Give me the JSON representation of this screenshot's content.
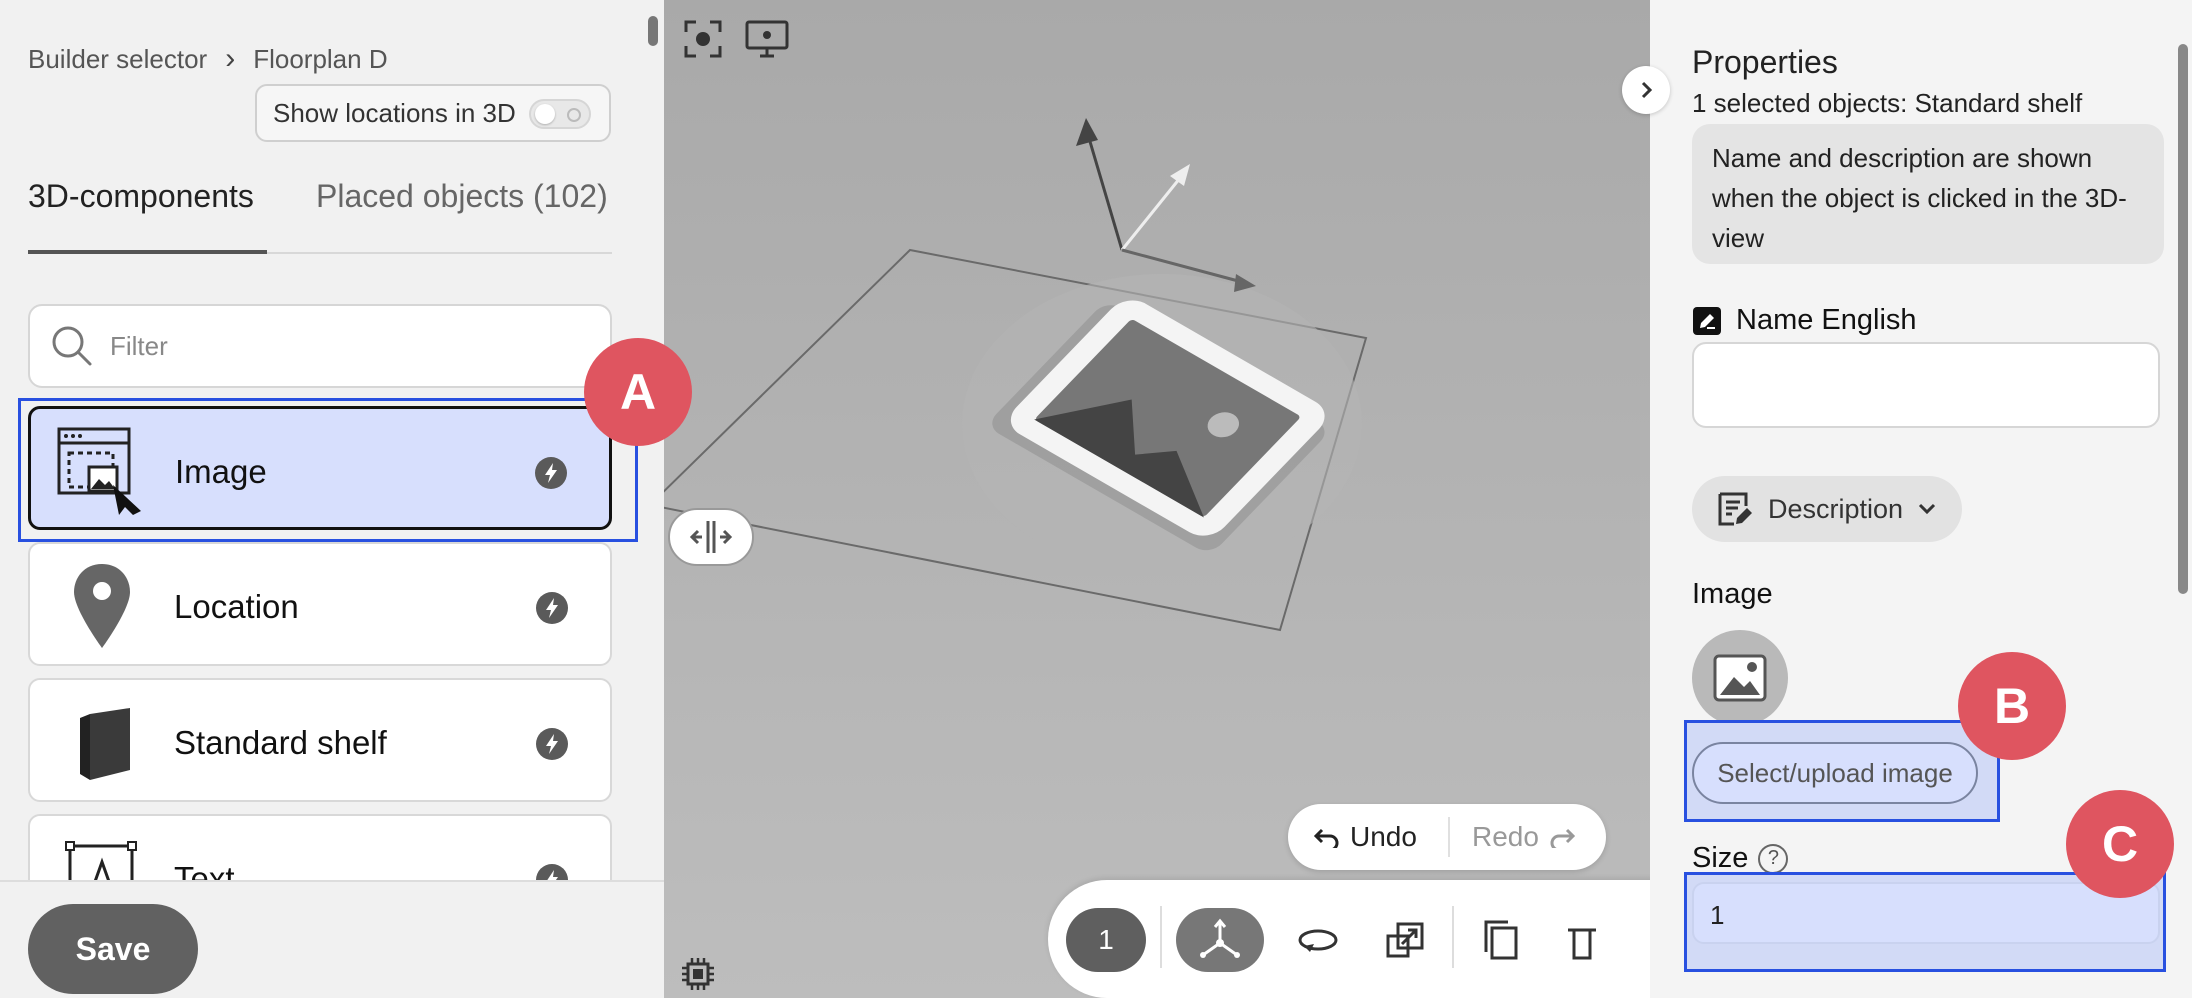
{
  "breadcrumb": {
    "root": "Builder selector",
    "current": "Floorplan D"
  },
  "show_locations_toggle": {
    "label": "Show locations in 3D",
    "checked": false
  },
  "tabs": [
    {
      "label": "3D-components",
      "active": true
    },
    {
      "label": "Placed objects (102)",
      "active": false
    }
  ],
  "filter": {
    "placeholder": "Filter"
  },
  "components": [
    {
      "label": "Image",
      "icon": "image-component-icon",
      "selected": true
    },
    {
      "label": "Location",
      "icon": "location-pin-icon",
      "selected": false
    },
    {
      "label": "Standard shelf",
      "icon": "shelf-cube-icon",
      "selected": false
    },
    {
      "label": "Text",
      "icon": "text-frame-icon",
      "selected": false
    }
  ],
  "save_label": "Save",
  "annotations": {
    "a": "A",
    "b": "B",
    "c": "C"
  },
  "viewport": {
    "undo_label": "Undo",
    "redo_label": "Redo",
    "selection_count": "1"
  },
  "properties": {
    "title": "Properties",
    "subtitle": "1 selected objects: Standard shelf",
    "info": "Name and description are shown when the object is clicked in the 3D-view",
    "name_label": "Name English",
    "name_value": "",
    "description_label": "Description",
    "image_label": "Image",
    "upload_label": "Select/upload image",
    "size_label": "Size",
    "size_value": "1"
  },
  "colors": {
    "accent_selection": "#d7dffd",
    "highlight_border": "#2850e0",
    "badge": "#df5560"
  }
}
